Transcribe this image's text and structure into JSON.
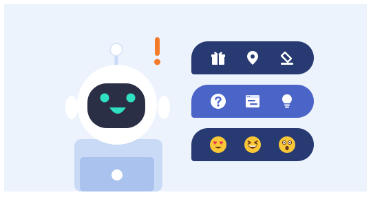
{
  "colors": {
    "background": "#edf3fd",
    "bubble_dark": "#273a72",
    "bubble_accent": "#4b64c8",
    "robot_white": "#ffffff",
    "robot_face": "#2b2f45",
    "robot_eye": "#2fe0c2",
    "robot_light_blue": "#c9daf6",
    "alert_orange": "#f47b2a",
    "emoji_yellow": "#f9c737"
  },
  "robot": {
    "alert_symbol": "!",
    "expression": "smiling"
  },
  "bubbles": [
    {
      "style": "dark",
      "icons": [
        "gift-icon",
        "location-pin-icon",
        "eraser-icon"
      ]
    },
    {
      "style": "accent",
      "icons": [
        "question-icon",
        "browser-window-icon",
        "lightbulb-icon"
      ]
    },
    {
      "style": "dark",
      "icons": [
        "heart-eyes-emoji-icon",
        "laughing-emoji-icon",
        "surprised-emoji-icon"
      ]
    }
  ]
}
